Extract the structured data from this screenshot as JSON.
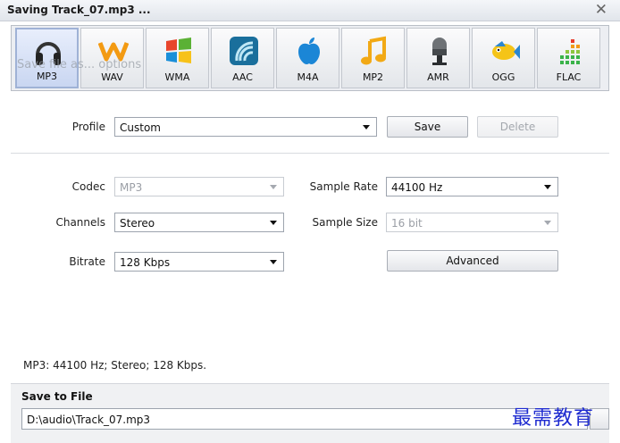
{
  "window": {
    "title": "Saving Track_07.mp3 ..."
  },
  "toolbar": {
    "ghost_text": "Save file as... options",
    "formats": [
      {
        "label": "MP3",
        "icon": "headphones-icon",
        "selected": true
      },
      {
        "label": "WAV",
        "icon": "wav-wave-icon",
        "selected": false
      },
      {
        "label": "WMA",
        "icon": "windows-logo-icon",
        "selected": false
      },
      {
        "label": "AAC",
        "icon": "aac-swirl-icon",
        "selected": false
      },
      {
        "label": "M4A",
        "icon": "apple-logo-icon",
        "selected": false
      },
      {
        "label": "MP2",
        "icon": "music-note-icon",
        "selected": false
      },
      {
        "label": "AMR",
        "icon": "microphone-icon",
        "selected": false
      },
      {
        "label": "OGG",
        "icon": "fish-icon",
        "selected": false
      },
      {
        "label": "FLAC",
        "icon": "equalizer-icon",
        "selected": false
      }
    ]
  },
  "profile": {
    "label": "Profile",
    "value": "Custom",
    "save": "Save",
    "delete": "Delete"
  },
  "settings": {
    "codec": {
      "label": "Codec",
      "value": "MP3"
    },
    "channels": {
      "label": "Channels",
      "value": "Stereo"
    },
    "bitrate": {
      "label": "Bitrate",
      "value": "128 Kbps"
    },
    "sample_rate": {
      "label": "Sample Rate",
      "value": "44100 Hz"
    },
    "sample_size": {
      "label": "Sample Size",
      "value": "16 bit"
    },
    "advanced": "Advanced"
  },
  "summary": "MP3: 44100  Hz; Stereo; 128 Kbps.",
  "save_to_file": {
    "label": "Save to File",
    "path": "D:\\audio\\Track_07.mp3"
  },
  "watermark": "最需教育",
  "colors": {
    "selected_bg": "#c9d6f1",
    "selected_border": "#9fb2d6",
    "watermark": "#1e2bd0"
  }
}
